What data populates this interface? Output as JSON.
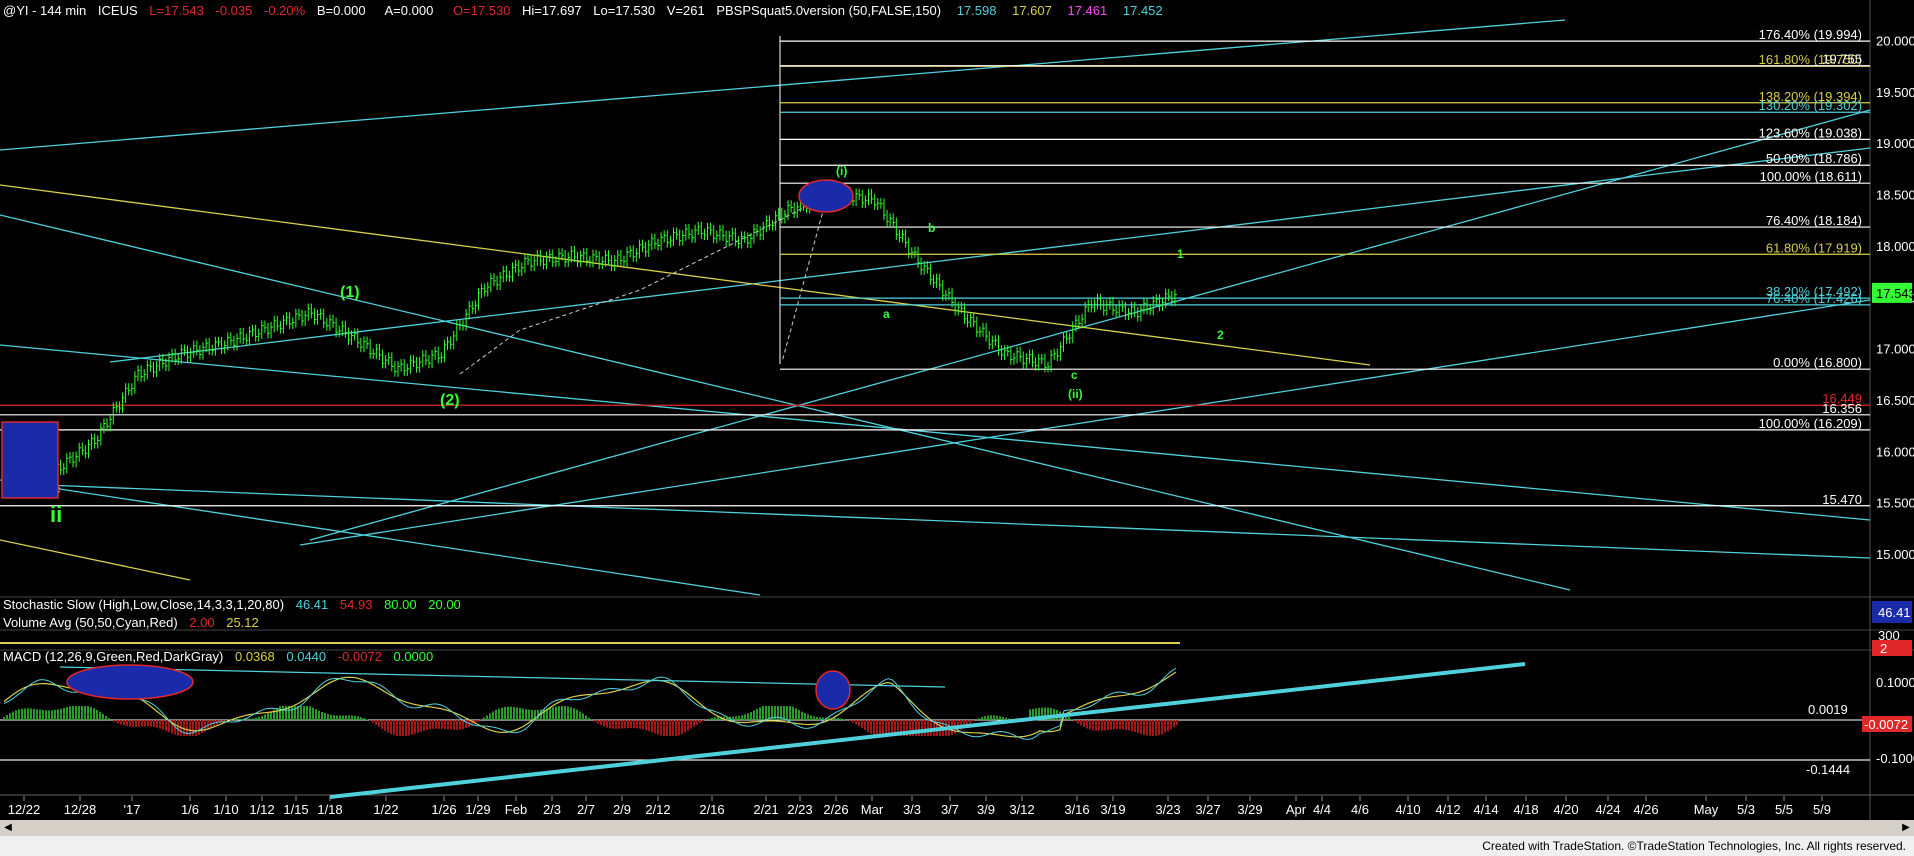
{
  "header": {
    "symbol": "@YI - 144 min",
    "exchange": "ICEUS",
    "last": "L=17.543",
    "change": "-0.035",
    "change_pct": "-0.20%",
    "bid": "B=0.000",
    "ask": "A=0.000",
    "open": "O=17.530",
    "high": "Hi=17.697",
    "low": "Lo=17.530",
    "volume": "V=261",
    "study": "PBSPSquat5.0version (50,FALSE,150)",
    "study_v1": "17.598",
    "study_v2": "17.607",
    "study_v3": "17.461",
    "study_v4": "17.452"
  },
  "colors": {
    "background": "#000000",
    "cyan": "#4fd1dc",
    "yellow": "#d8cf4a",
    "white": "#e8e8e8",
    "red": "#e0282a",
    "green": "#33ff33",
    "blue": "#1a2aa8"
  },
  "stochastic": {
    "label": "Stochastic Slow (High,Low,Close,14,3,3,1,20,80)",
    "v1": "46.41",
    "v2": "54.93",
    "v3": "80.00",
    "v4": "20.00",
    "axis_tag": "46.41"
  },
  "volume": {
    "label": "Volume Avg (50,50,Cyan,Red)",
    "v1": "2.00",
    "v2": "25.12",
    "axis_tag_1": "300",
    "axis_tag_2": "2"
  },
  "macd": {
    "label": "MACD (12,26,9,Green,Red,DarkGray)",
    "v1": "0.0368",
    "v2": "0.0440",
    "v3": "-0.0072",
    "v4": "0.0000",
    "ticks": [
      "0.1000",
      "-0.1000"
    ],
    "tag_top": "0.0019",
    "tag_red": "-0.0072",
    "tag_bottom": "-0.1444"
  },
  "price_axis": {
    "ticks": [
      "20.000",
      "19.500",
      "19.000",
      "18.500",
      "18.000",
      "17.500",
      "17.000",
      "16.500",
      "16.000",
      "15.500",
      "15.000"
    ],
    "last_tag": "17.543",
    "range": [
      14.65,
      20.2
    ]
  },
  "fib_levels": [
    {
      "label": "176.40% (19.994)",
      "value": 19.994,
      "color": "#ffffff"
    },
    {
      "label": "161.80% (19.750)",
      "value": 19.75,
      "color": "#d8cf4a"
    },
    {
      "label": "19.755",
      "value": 19.755,
      "color": "#ffffff"
    },
    {
      "label": "138.20% (19.394)",
      "value": 19.394,
      "color": "#d8cf4a"
    },
    {
      "label": "130.20% (19.302)",
      "value": 19.302,
      "color": "#4fd1dc"
    },
    {
      "label": "123.60% (19.038)",
      "value": 19.038,
      "color": "#ffffff"
    },
    {
      "label": "50.00% (18.786)",
      "value": 18.786,
      "color": "#ffffff"
    },
    {
      "label": "100.00% (18.611)",
      "value": 18.611,
      "color": "#ffffff"
    },
    {
      "label": "76.40% (18.184)",
      "value": 18.184,
      "color": "#ffffff"
    },
    {
      "label": "61.80% (17.919)",
      "value": 17.919,
      "color": "#d8cf4a"
    },
    {
      "label": "38.20% (17.492)",
      "value": 17.492,
      "color": "#4fd1dc"
    },
    {
      "label": "76.40% (17.426)",
      "value": 17.426,
      "color": "#4fd1dc"
    },
    {
      "label": "0.00% (16.800)",
      "value": 16.8,
      "color": "#ffffff"
    },
    {
      "label": "16.449",
      "value": 16.449,
      "color": "#e0282a"
    },
    {
      "label": "16.356",
      "value": 16.356,
      "color": "#ffffff"
    },
    {
      "label": "100.00% (16.209)",
      "value": 16.209,
      "color": "#ffffff"
    },
    {
      "label": "15.470",
      "value": 15.47,
      "color": "#ffffff"
    }
  ],
  "wave_labels": [
    {
      "text": "(1)",
      "color": "#33ff33"
    },
    {
      "text": "(2)",
      "color": "#33ff33"
    },
    {
      "text": "(i)",
      "color": "#33ff33"
    },
    {
      "text": "(ii)",
      "color": "#33ff33"
    },
    {
      "text": "a",
      "color": "#33ff33"
    },
    {
      "text": "b",
      "color": "#33ff33"
    },
    {
      "text": "c",
      "color": "#33ff33"
    },
    {
      "text": "c",
      "color": "#4fd1dc"
    },
    {
      "text": "ii",
      "color": "#33ff33"
    },
    {
      "text": "1",
      "color": "#33ff33"
    },
    {
      "text": "2",
      "color": "#33ff33"
    }
  ],
  "dates": [
    "12/22",
    "12/28",
    "'17",
    "1/6",
    "1/10",
    "1/12",
    "1/15",
    "1/18",
    "1/22",
    "1/26",
    "1/29",
    "Feb",
    "2/3",
    "2/7",
    "2/9",
    "2/12",
    "2/16",
    "2/21",
    "2/23",
    "2/26",
    "Mar",
    "3/3",
    "3/7",
    "3/9",
    "3/12",
    "3/16",
    "3/19",
    "3/23",
    "3/27",
    "3/29",
    "Apr",
    "4/4",
    "4/6",
    "4/10",
    "4/12",
    "4/14",
    "4/18",
    "4/20",
    "4/24",
    "4/26",
    "May",
    "5/3",
    "5/5",
    "5/9"
  ],
  "chart_data": {
    "type": "line",
    "title": "@YI - 144 min",
    "xlabel": "",
    "ylabel": "",
    "ylim": [
      14.65,
      20.2
    ],
    "series": [
      {
        "x": [
          "12/22",
          "12/28",
          "'17",
          "1/6",
          "1/10",
          "1/12",
          "1/15",
          "1/18",
          "1/22",
          "1/26",
          "1/29",
          "Feb",
          "2/3",
          "2/7",
          "2/9",
          "2/12",
          "2/16",
          "2/21",
          "2/23",
          "2/26",
          "Mar",
          "3/3",
          "3/7",
          "3/9",
          "3/12",
          "3/16",
          "3/19",
          "3/23"
        ],
        "values": [
          16.15,
          15.78,
          16.1,
          16.75,
          16.95,
          17.05,
          17.2,
          17.35,
          17.1,
          16.8,
          16.95,
          17.6,
          17.85,
          17.9,
          17.85,
          18.05,
          18.15,
          18.05,
          18.35,
          18.5,
          18.45,
          17.85,
          17.35,
          16.95,
          16.85,
          17.45,
          17.35,
          17.54
        ]
      }
    ]
  },
  "footer": "Created with TradeStation. ©TradeStation Technologies, Inc. All rights reserved."
}
